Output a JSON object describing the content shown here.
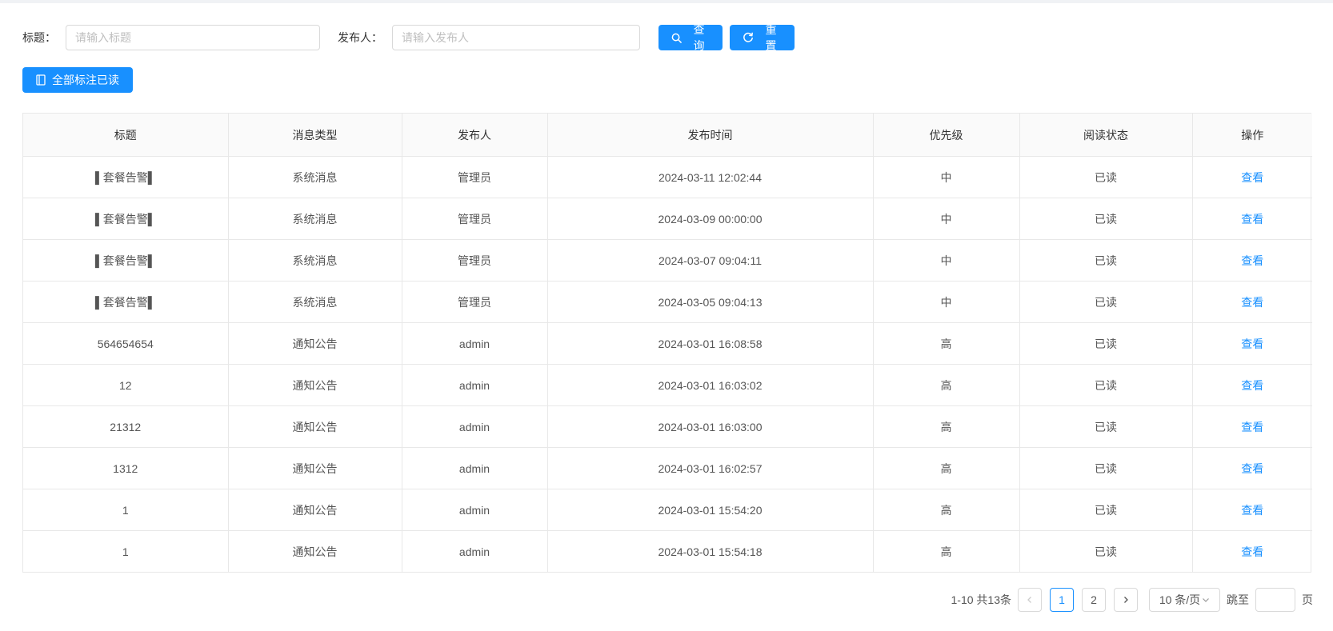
{
  "search": {
    "title_label": "标题：",
    "title_placeholder": "请输入标题",
    "title_value": "",
    "publisher_label": "发布人：",
    "publisher_placeholder": "请输入发布人",
    "publisher_value": "",
    "query_label": "查询",
    "reset_label": "重置"
  },
  "toolbar": {
    "mark_all_read_label": "全部标注已读"
  },
  "table": {
    "columns": [
      "标题",
      "消息类型",
      "发布人",
      "发布时间",
      "优先级",
      "阅读状态",
      "操作"
    ],
    "rows": [
      {
        "title": "▌套餐告警▌",
        "type": "系统消息",
        "publisher": "管理员",
        "time": "2024-03-11 12:02:44",
        "priority": "中",
        "status": "已读",
        "action": "查看"
      },
      {
        "title": "▌套餐告警▌",
        "type": "系统消息",
        "publisher": "管理员",
        "time": "2024-03-09 00:00:00",
        "priority": "中",
        "status": "已读",
        "action": "查看"
      },
      {
        "title": "▌套餐告警▌",
        "type": "系统消息",
        "publisher": "管理员",
        "time": "2024-03-07 09:04:11",
        "priority": "中",
        "status": "已读",
        "action": "查看"
      },
      {
        "title": "▌套餐告警▌",
        "type": "系统消息",
        "publisher": "管理员",
        "time": "2024-03-05 09:04:13",
        "priority": "中",
        "status": "已读",
        "action": "查看"
      },
      {
        "title": "564654654",
        "type": "通知公告",
        "publisher": "admin",
        "time": "2024-03-01 16:08:58",
        "priority": "高",
        "status": "已读",
        "action": "查看"
      },
      {
        "title": "12",
        "type": "通知公告",
        "publisher": "admin",
        "time": "2024-03-01 16:03:02",
        "priority": "高",
        "status": "已读",
        "action": "查看"
      },
      {
        "title": "21312",
        "type": "通知公告",
        "publisher": "admin",
        "time": "2024-03-01 16:03:00",
        "priority": "高",
        "status": "已读",
        "action": "查看"
      },
      {
        "title": "1312",
        "type": "通知公告",
        "publisher": "admin",
        "time": "2024-03-01 16:02:57",
        "priority": "高",
        "status": "已读",
        "action": "查看"
      },
      {
        "title": "1",
        "type": "通知公告",
        "publisher": "admin",
        "time": "2024-03-01 15:54:20",
        "priority": "高",
        "status": "已读",
        "action": "查看"
      },
      {
        "title": "1",
        "type": "通知公告",
        "publisher": "admin",
        "time": "2024-03-01 15:54:18",
        "priority": "高",
        "status": "已读",
        "action": "查看"
      }
    ]
  },
  "pagination": {
    "total_text": "1-10 共13条",
    "pages": [
      "1",
      "2"
    ],
    "current_page": "1",
    "page_size_label": "10 条/页",
    "jump_prefix": "跳至",
    "jump_value": "",
    "jump_suffix": "页"
  },
  "colors": {
    "primary": "#1890ff",
    "page_background": "#f0f2f5"
  },
  "icons": {
    "query": "search-icon",
    "reset": "reload-icon",
    "mark_all_read": "book-icon",
    "prev": "chevron-left-icon",
    "next": "chevron-right-icon",
    "page_size": "chevron-down-icon"
  }
}
